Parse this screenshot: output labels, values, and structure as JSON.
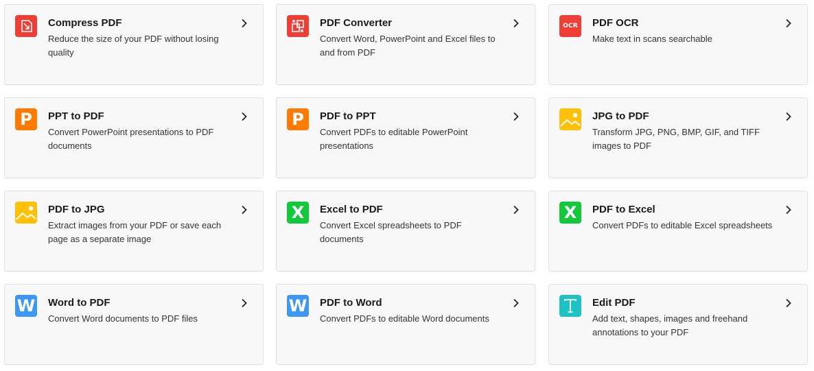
{
  "colors": {
    "red": "#EF3E36",
    "orange": "#FF7A00",
    "yellow": "#FFC107",
    "green": "#12C93C",
    "blue": "#3D98F4",
    "teal": "#1EC2C2"
  },
  "tools": [
    {
      "title": "Compress PDF",
      "desc": "Reduce the size of your PDF without losing quality",
      "icon": "compress-icon",
      "color": "#EF3E36"
    },
    {
      "title": "PDF Converter",
      "desc": "Convert Word, PowerPoint and Excel files to and from PDF",
      "icon": "convert-icon",
      "color": "#EF3E36"
    },
    {
      "title": "PDF OCR",
      "desc": "Make text in scans searchable",
      "icon": "ocr-icon",
      "color": "#EF3E36",
      "icon_text": "OCR"
    },
    {
      "title": "PPT to PDF",
      "desc": "Convert PowerPoint presentations to PDF documents",
      "icon": "powerpoint-icon",
      "color": "#FF7A00",
      "icon_text": "P"
    },
    {
      "title": "PDF to PPT",
      "desc": "Convert PDFs to editable PowerPoint presentations",
      "icon": "powerpoint-icon",
      "color": "#FF7A00",
      "icon_text": "P"
    },
    {
      "title": "JPG to PDF",
      "desc": "Transform JPG, PNG, BMP, GIF, and TIFF images to PDF",
      "icon": "image-icon",
      "color": "#FFC107"
    },
    {
      "title": "PDF to JPG",
      "desc": "Extract images from your PDF or save each page as a separate image",
      "icon": "image-icon",
      "color": "#FFC107"
    },
    {
      "title": "Excel to PDF",
      "desc": "Convert Excel spreadsheets to PDF documents",
      "icon": "excel-icon",
      "color": "#12C93C",
      "icon_text": "X"
    },
    {
      "title": "PDF to Excel",
      "desc": "Convert PDFs to editable Excel spreadsheets",
      "icon": "excel-icon",
      "color": "#12C93C",
      "icon_text": "X"
    },
    {
      "title": "Word to PDF",
      "desc": "Convert Word documents to PDF files",
      "icon": "word-icon",
      "color": "#3D98F4",
      "icon_text": "W"
    },
    {
      "title": "PDF to Word",
      "desc": "Convert PDFs to editable Word documents",
      "icon": "word-icon",
      "color": "#3D98F4",
      "icon_text": "W"
    },
    {
      "title": "Edit PDF",
      "desc": "Add text, shapes, images and freehand annotations to your PDF",
      "icon": "text-edit-icon",
      "color": "#1EC2C2"
    }
  ]
}
